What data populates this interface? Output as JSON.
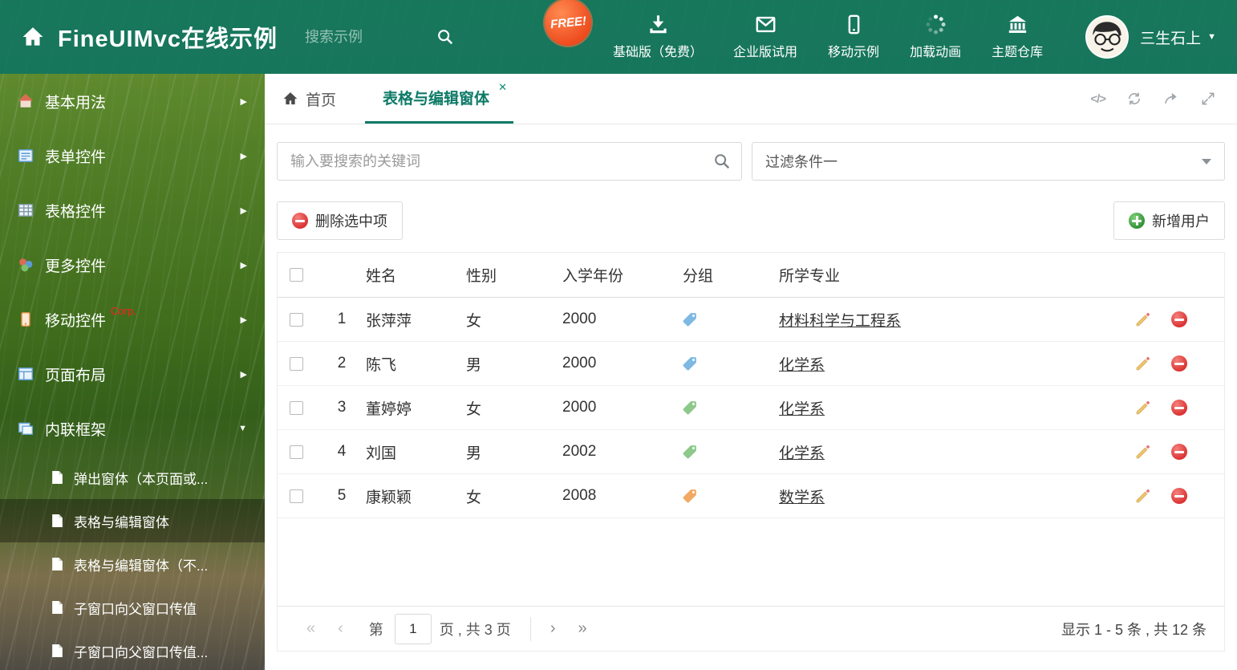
{
  "glyphs": {
    "code": "</>",
    "close": "✕",
    "caret_down": "▼",
    "collapsed": "▶",
    "expanded": "▼",
    "first": "«",
    "prev": "‹",
    "next": "›",
    "last": "»"
  },
  "header": {
    "title": "FineUIMvc在线示例",
    "search_placeholder": "搜索示例",
    "free_badge": "FREE!",
    "nav": [
      {
        "label": "基础版（免费）"
      },
      {
        "label": "企业版试用"
      },
      {
        "label": "移动示例"
      },
      {
        "label": "加载动画"
      },
      {
        "label": "主题仓库"
      }
    ],
    "user": "三生石上"
  },
  "sidebar": {
    "items": [
      {
        "label": "基本用法"
      },
      {
        "label": "表单控件"
      },
      {
        "label": "表格控件"
      },
      {
        "label": "更多控件"
      },
      {
        "label": "移动控件",
        "badge": "Corp."
      },
      {
        "label": "页面布局"
      },
      {
        "label": "内联框架"
      }
    ],
    "subitems": [
      {
        "label": "弹出窗体（本页面或..."
      },
      {
        "label": "表格与编辑窗体"
      },
      {
        "label": "表格与编辑窗体（不..."
      },
      {
        "label": "子窗口向父窗口传值"
      },
      {
        "label": "子窗口向父窗口传值..."
      }
    ]
  },
  "tabs": {
    "home_label": "首页",
    "active_label": "表格与编辑窗体"
  },
  "filterbar": {
    "search_placeholder": "输入要搜索的关键词",
    "filter_value": "过滤条件一"
  },
  "toolbar": {
    "delete_label": "删除选中项",
    "add_label": "新增用户"
  },
  "table": {
    "columns": {
      "name": "姓名",
      "gender": "性别",
      "year": "入学年份",
      "group": "分组",
      "major": "所学专业"
    },
    "rows": [
      {
        "num": "1",
        "name": "张萍萍",
        "gender": "女",
        "year": "2000",
        "tag_color": "#7db9e3",
        "major": "材料科学与工程系"
      },
      {
        "num": "2",
        "name": "陈飞",
        "gender": "男",
        "year": "2000",
        "tag_color": "#7db9e3",
        "major": "化学系"
      },
      {
        "num": "3",
        "name": "董婷婷",
        "gender": "女",
        "year": "2000",
        "tag_color": "#8ec98b",
        "major": "化学系"
      },
      {
        "num": "4",
        "name": "刘国",
        "gender": "男",
        "year": "2002",
        "tag_color": "#8ec98b",
        "major": "化学系"
      },
      {
        "num": "5",
        "name": "康颖颖",
        "gender": "女",
        "year": "2008",
        "tag_color": "#f2a964",
        "major": "数学系"
      }
    ]
  },
  "pagination": {
    "page_label": "第",
    "current_page": "1",
    "total_label": "页 , 共 3 页",
    "summary": "显示 1 - 5 条 , 共 12 条"
  },
  "colors": {
    "accent": "#0d7a66",
    "danger": "#d92f2f",
    "success": "#2f8f33"
  }
}
